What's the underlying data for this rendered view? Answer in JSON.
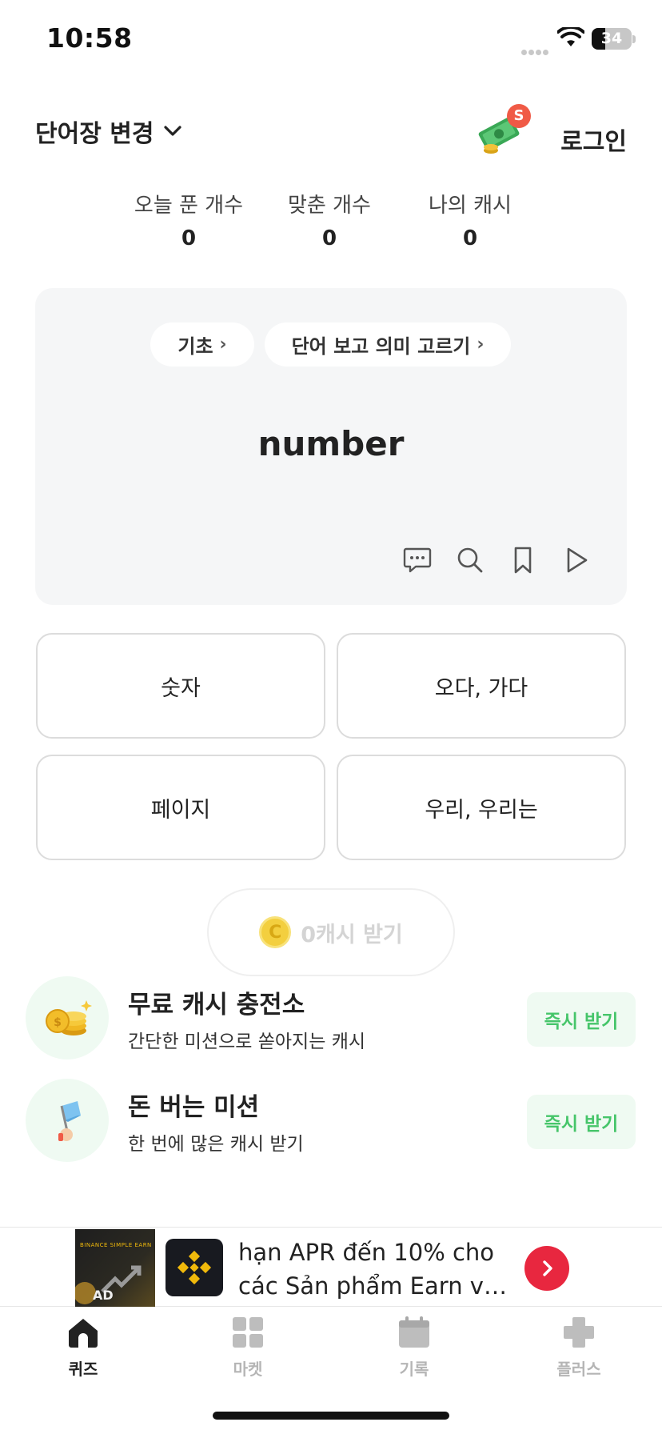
{
  "status_bar": {
    "time": "10:58",
    "battery": "34",
    "battery_level": 0.34
  },
  "header": {
    "wordbook_label": "단어장 변경",
    "cash_badge": "S",
    "login_label": "로그인"
  },
  "stats": [
    {
      "label": "오늘 푼 개수",
      "value": "0"
    },
    {
      "label": "맞춘 개수",
      "value": "0"
    },
    {
      "label": "나의 캐시",
      "value": "0"
    }
  ],
  "quiz": {
    "level_chip": "기초",
    "mode_chip": "단어 보고 의미 고르기",
    "word": "number",
    "tools": [
      "comment-icon",
      "search-icon",
      "bookmark-icon",
      "play-icon"
    ]
  },
  "answers": [
    "숫자",
    "오다, 가다",
    "페이지",
    "우리, 우리는"
  ],
  "reward": {
    "coin_symbol": "C",
    "label": "0캐시 받기"
  },
  "promos": [
    {
      "title": "무료 캐시 충전소",
      "subtitle": "간단한 미션으로 쏟아지는 캐시",
      "button": "즉시 받기",
      "icon": "coins-icon"
    },
    {
      "title": "돈 버는 미션",
      "subtitle": "한 번에 많은 캐시 받기",
      "button": "즉시 받기",
      "icon": "flag-icon"
    }
  ],
  "ad": {
    "thumb_brand": "BINANCE SIMPLE EARN",
    "thumb_tag": "AD",
    "line1": "hạn APR đến 10% cho",
    "line2": "các Sản phẩm Earn vớ…"
  },
  "tabs": [
    {
      "label": "퀴즈",
      "icon": "home-icon",
      "active": true
    },
    {
      "label": "마켓",
      "icon": "grid-icon",
      "active": false
    },
    {
      "label": "기록",
      "icon": "calendar-icon",
      "active": false
    },
    {
      "label": "플러스",
      "icon": "plus-icon",
      "active": false
    }
  ],
  "colors": {
    "accent_green": "#46c56a",
    "promo_bg": "#effaf2",
    "ad_cta": "#e8273f",
    "badge": "#f05a46",
    "card_bg": "#f5f6f7"
  }
}
